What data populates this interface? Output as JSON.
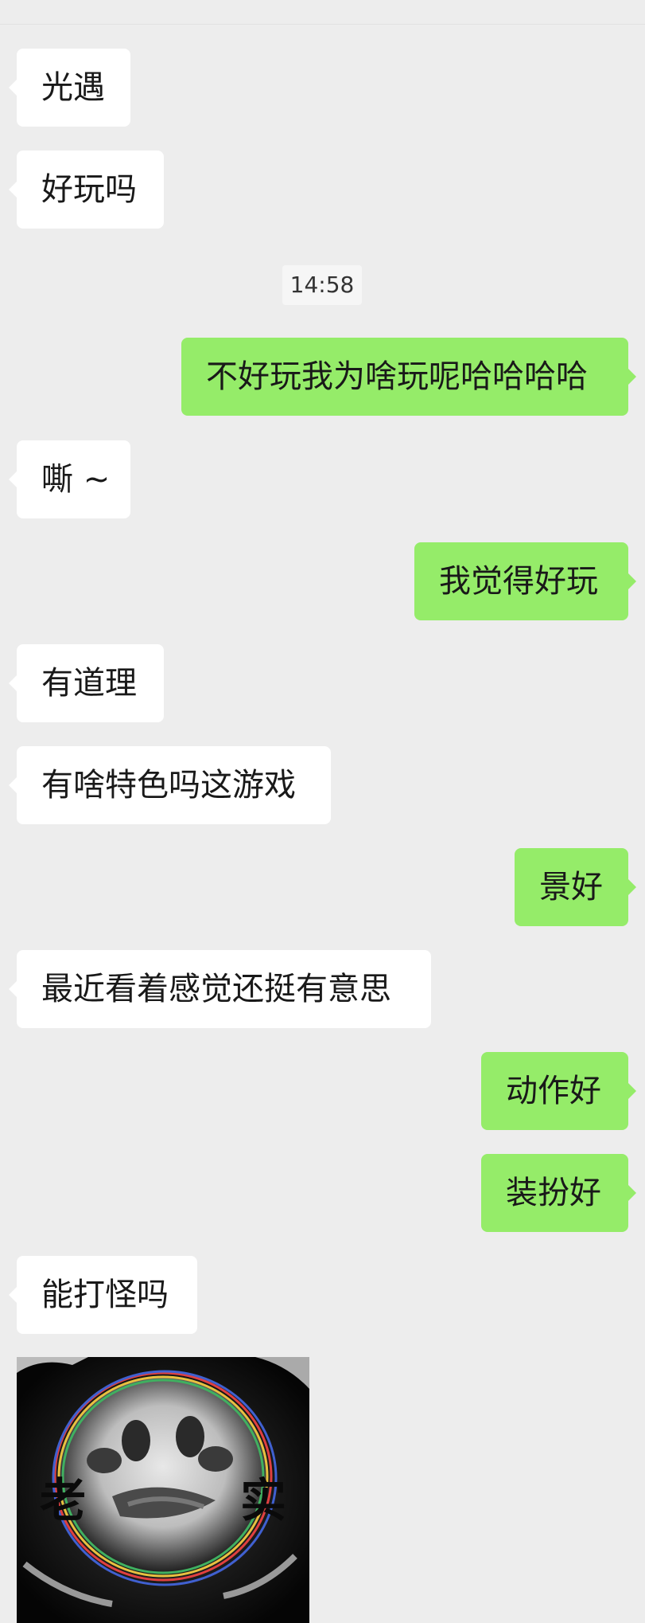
{
  "timestamp": "14:58",
  "messages": [
    {
      "id": "m1",
      "side": "left",
      "text": "光遇"
    },
    {
      "id": "m2",
      "side": "left",
      "text": "好玩吗"
    },
    {
      "id": "m3",
      "side": "right",
      "text": "不好玩我为啥玩呢哈哈哈哈"
    },
    {
      "id": "m4",
      "side": "left",
      "text": "嘶 ~"
    },
    {
      "id": "m5",
      "side": "right",
      "text": "我觉得好玩"
    },
    {
      "id": "m6",
      "side": "left",
      "text": "有道理"
    },
    {
      "id": "m7",
      "side": "left",
      "text": "有啥特色吗这游戏"
    },
    {
      "id": "m8",
      "side": "right",
      "text": "景好"
    },
    {
      "id": "m9",
      "side": "left",
      "text": "最近看着感觉还挺有意思"
    },
    {
      "id": "m10",
      "side": "right",
      "text": "动作好"
    },
    {
      "id": "m11",
      "side": "right",
      "text": "装扮好"
    },
    {
      "id": "m12",
      "side": "left",
      "text": "能打怪吗"
    }
  ],
  "sticker": {
    "left_text": "老",
    "right_text": "实"
  },
  "colors": {
    "background": "#ededed",
    "incoming_bubble": "#ffffff",
    "outgoing_bubble": "#95ec69"
  }
}
